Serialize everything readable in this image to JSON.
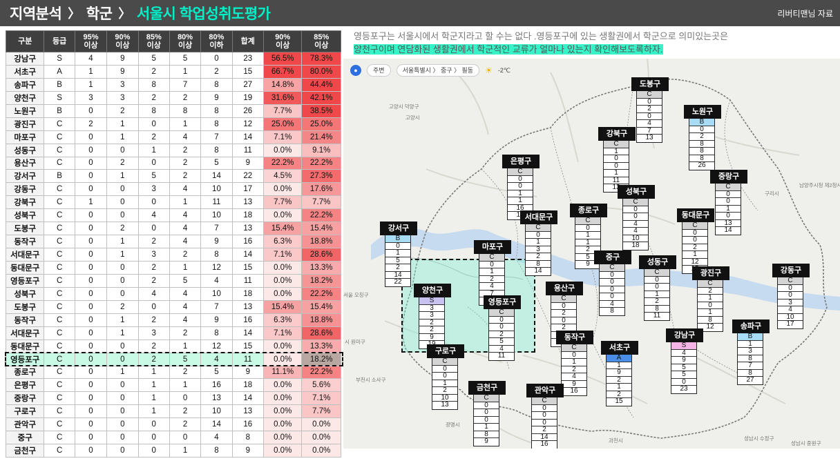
{
  "header": {
    "crumb1": "지역분석",
    "crumb2": "학군",
    "crumb3": "서울시 학업성취도평가",
    "separator": "〉",
    "source": "리버티맨님 자료"
  },
  "table": {
    "headers": [
      {
        "l1": "구분",
        "l2": ""
      },
      {
        "l1": "등급",
        "l2": ""
      },
      {
        "l1": "95%",
        "l2": "이상"
      },
      {
        "l1": "90%",
        "l2": "이상"
      },
      {
        "l1": "85%",
        "l2": "이상"
      },
      {
        "l1": "80%",
        "l2": "이상"
      },
      {
        "l1": "80%",
        "l2": "이하"
      },
      {
        "l1": "합계",
        "l2": ""
      },
      {
        "l1": "90%",
        "l2": "이상"
      },
      {
        "l1": "85%",
        "l2": "이상"
      }
    ],
    "rows": [
      [
        "강남구",
        "S",
        "4",
        "9",
        "5",
        "5",
        "0",
        "23",
        "56.5%",
        "78.3%"
      ],
      [
        "서초구",
        "A",
        "1",
        "9",
        "2",
        "1",
        "2",
        "15",
        "66.7%",
        "80.0%"
      ],
      [
        "송파구",
        "B",
        "1",
        "3",
        "8",
        "7",
        "8",
        "27",
        "14.8%",
        "44.4%"
      ],
      [
        "양천구",
        "S",
        "3",
        "3",
        "2",
        "2",
        "9",
        "19",
        "31.6%",
        "42.1%"
      ],
      [
        "노원구",
        "B",
        "0",
        "2",
        "8",
        "8",
        "8",
        "26",
        "7.7%",
        "38.5%"
      ],
      [
        "광진구",
        "C",
        "2",
        "1",
        "0",
        "1",
        "8",
        "12",
        "25.0%",
        "25.0%"
      ],
      [
        "마포구",
        "C",
        "0",
        "1",
        "2",
        "4",
        "7",
        "14",
        "7.1%",
        "21.4%"
      ],
      [
        "성동구",
        "C",
        "0",
        "0",
        "1",
        "2",
        "8",
        "11",
        "0.0%",
        "9.1%"
      ],
      [
        "용산구",
        "C",
        "0",
        "2",
        "0",
        "2",
        "5",
        "9",
        "22.2%",
        "22.2%"
      ],
      [
        "강서구",
        "B",
        "0",
        "1",
        "5",
        "2",
        "14",
        "22",
        "4.5%",
        "27.3%"
      ],
      [
        "강동구",
        "C",
        "0",
        "0",
        "3",
        "4",
        "10",
        "17",
        "0.0%",
        "17.6%"
      ],
      [
        "강북구",
        "C",
        "1",
        "0",
        "0",
        "1",
        "11",
        "13",
        "7.7%",
        "7.7%"
      ],
      [
        "성북구",
        "C",
        "0",
        "0",
        "4",
        "4",
        "10",
        "18",
        "0.0%",
        "22.2%"
      ],
      [
        "도봉구",
        "C",
        "0",
        "2",
        "0",
        "4",
        "7",
        "13",
        "15.4%",
        "15.4%"
      ],
      [
        "동작구",
        "C",
        "0",
        "1",
        "2",
        "4",
        "9",
        "16",
        "6.3%",
        "18.8%"
      ],
      [
        "서대문구",
        "C",
        "0",
        "1",
        "3",
        "2",
        "8",
        "14",
        "7.1%",
        "28.6%"
      ],
      [
        "동대문구",
        "C",
        "0",
        "0",
        "2",
        "1",
        "12",
        "15",
        "0.0%",
        "13.3%"
      ],
      [
        "영등포구",
        "C",
        "0",
        "0",
        "2",
        "5",
        "4",
        "11",
        "0.0%",
        "18.2%"
      ],
      [
        "성북구",
        "C",
        "0",
        "0",
        "4",
        "4",
        "10",
        "18",
        "0.0%",
        "22.2%"
      ],
      [
        "도봉구",
        "C",
        "0",
        "2",
        "0",
        "4",
        "7",
        "13",
        "15.4%",
        "15.4%"
      ],
      [
        "동작구",
        "C",
        "0",
        "1",
        "2",
        "4",
        "9",
        "16",
        "6.3%",
        "18.8%"
      ],
      [
        "서대문구",
        "C",
        "0",
        "1",
        "3",
        "2",
        "8",
        "14",
        "7.1%",
        "28.6%"
      ],
      [
        "동대문구",
        "C",
        "0",
        "0",
        "2",
        "1",
        "12",
        "15",
        "0.0%",
        "13.3%"
      ],
      [
        "영등포구",
        "C",
        "0",
        "0",
        "2",
        "5",
        "4",
        "11",
        "0.0%",
        "18.2%"
      ],
      [
        "종로구",
        "C",
        "0",
        "1",
        "1",
        "2",
        "5",
        "9",
        "11.1%",
        "22.2%"
      ],
      [
        "은평구",
        "C",
        "0",
        "0",
        "1",
        "1",
        "16",
        "18",
        "0.0%",
        "5.6%"
      ],
      [
        "중랑구",
        "C",
        "0",
        "0",
        "1",
        "0",
        "13",
        "14",
        "0.0%",
        "7.1%"
      ],
      [
        "구로구",
        "C",
        "0",
        "0",
        "1",
        "2",
        "10",
        "13",
        "0.0%",
        "7.7%"
      ],
      [
        "관악구",
        "C",
        "0",
        "0",
        "0",
        "2",
        "14",
        "16",
        "0.0%",
        "0.0%"
      ],
      [
        "중구",
        "C",
        "0",
        "0",
        "0",
        "0",
        "4",
        "8",
        "0.0%",
        "0.0%"
      ],
      [
        "금천구",
        "C",
        "0",
        "0",
        "0",
        "1",
        "8",
        "9",
        "0.0%",
        "0.0%"
      ]
    ],
    "highlight_row_index": 23,
    "colors": {
      "header": "#3f3f3f",
      "high": "#f0484a",
      "low": "#fde4e4",
      "highlight": "#c9fae6"
    }
  },
  "description": {
    "line1": "영등포구는 서울시에서 학군지라고 할 수는 없다 .영등포구에 있는 생활권에서 학군으로 의미있는곳은",
    "line2": "양천구이며 연담화된 생활권에서 학군적인 교류가 얼마나 있는지 확인해보도록하자."
  },
  "map": {
    "toolbar": {
      "home": "주변",
      "path": "서울특별시 〉 중구 〉 필동",
      "weather": "-2℃",
      "pin_icon": "location-pin-icon",
      "weather_icon": "sun-icon"
    },
    "place_labels": [
      "고양시 덕양구",
      "고양시",
      "서울 오칭구",
      "시 원미구",
      "부천시 소사구",
      "광명시",
      "구리시",
      "남양주시청 제2청사",
      "과천시",
      "성남시 수정구",
      "성남시 중원구"
    ],
    "cards": [
      {
        "name": "도봉구",
        "vals": [
          "C",
          "0",
          "2",
          "0",
          "4",
          "7",
          "13"
        ]
      },
      {
        "name": "노원구",
        "vals": [
          "B",
          "0",
          "2",
          "8",
          "8",
          "8",
          "26"
        ]
      },
      {
        "name": "강북구",
        "vals": [
          "C",
          "1",
          "0",
          "0",
          "1",
          "11",
          "13"
        ]
      },
      {
        "name": "은평구",
        "vals": [
          "C",
          "0",
          "0",
          "1",
          "1",
          "16",
          "18"
        ]
      },
      {
        "name": "중랑구",
        "vals": [
          "C",
          "0",
          "0",
          "1",
          "0",
          "13",
          "14"
        ]
      },
      {
        "name": "성북구",
        "vals": [
          "C",
          "0",
          "0",
          "4",
          "4",
          "10",
          "18"
        ]
      },
      {
        "name": "강서구",
        "vals": [
          "B",
          "0",
          "1",
          "5",
          "2",
          "14",
          "22"
        ]
      },
      {
        "name": "서대문구",
        "vals": [
          "C",
          "0",
          "1",
          "3",
          "2",
          "8",
          "14"
        ]
      },
      {
        "name": "종로구",
        "vals": [
          "C",
          "0",
          "1",
          "1",
          "2",
          "5",
          "9"
        ]
      },
      {
        "name": "동대문구",
        "vals": [
          "C",
          "0",
          "0",
          "2",
          "1",
          "12",
          "15"
        ]
      },
      {
        "name": "마포구",
        "vals": [
          "C",
          "0",
          "1",
          "2",
          "4",
          "7",
          "14"
        ]
      },
      {
        "name": "중구",
        "vals": [
          "C",
          "0",
          "0",
          "0",
          "0",
          "4",
          "8"
        ]
      },
      {
        "name": "성동구",
        "vals": [
          "C",
          "0",
          "0",
          "1",
          "2",
          "8",
          "11"
        ]
      },
      {
        "name": "광진구",
        "vals": [
          "C",
          "2",
          "1",
          "0",
          "1",
          "8",
          "12"
        ]
      },
      {
        "name": "강동구",
        "vals": [
          "C",
          "0",
          "0",
          "3",
          "4",
          "10",
          "17"
        ]
      },
      {
        "name": "양천구",
        "vals": [
          "S",
          "3",
          "3",
          "2",
          "2",
          "9",
          "19"
        ]
      },
      {
        "name": "용산구",
        "vals": [
          "C",
          "0",
          "2",
          "0",
          "2",
          "5",
          "9"
        ]
      },
      {
        "name": "영등포구",
        "vals": [
          "C",
          "0",
          "0",
          "2",
          "5",
          "4",
          "11"
        ]
      },
      {
        "name": "구로구",
        "vals": [
          "C",
          "0",
          "0",
          "1",
          "2",
          "10",
          "13"
        ]
      },
      {
        "name": "동작구",
        "vals": [
          "C",
          "0",
          "1",
          "2",
          "4",
          "9",
          "16"
        ]
      },
      {
        "name": "서초구",
        "vals": [
          "A",
          "1",
          "9",
          "2",
          "1",
          "2",
          "15"
        ]
      },
      {
        "name": "강남구",
        "vals": [
          "S",
          "4",
          "9",
          "5",
          "5",
          "0",
          "23"
        ]
      },
      {
        "name": "송파구",
        "vals": [
          "B",
          "1",
          "3",
          "8",
          "7",
          "8",
          "27"
        ]
      },
      {
        "name": "금천구",
        "vals": [
          "C",
          "0",
          "0",
          "0",
          "1",
          "8",
          "9"
        ]
      },
      {
        "name": "관악구",
        "vals": [
          "C",
          "0",
          "0",
          "0",
          "2",
          "14",
          "16"
        ]
      }
    ]
  }
}
